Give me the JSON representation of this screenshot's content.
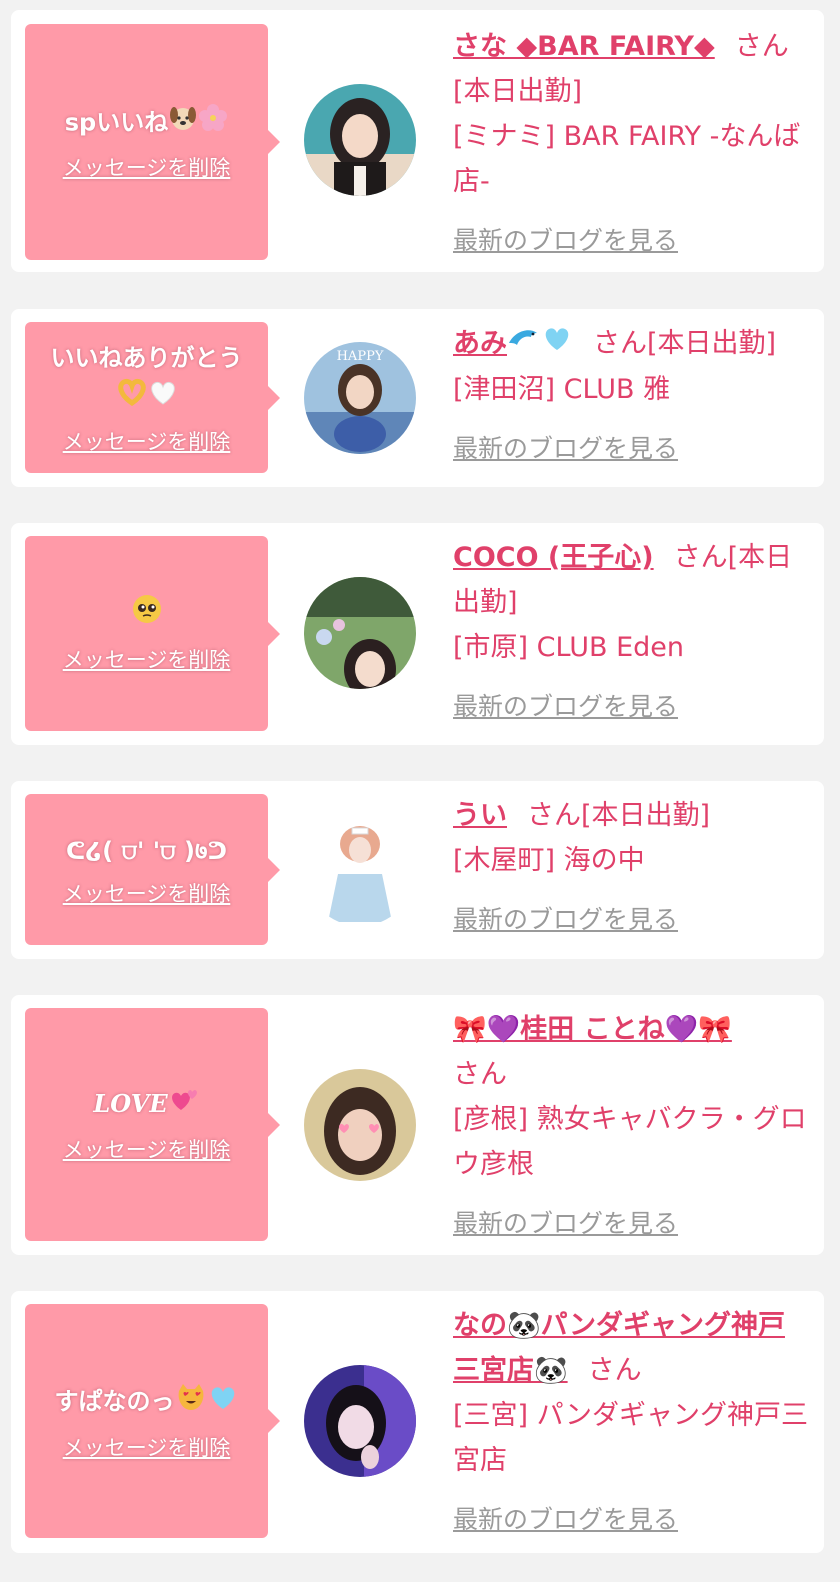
{
  "ui": {
    "delete_label": "メッセージを削除",
    "san_label": "さん",
    "blog_label": "最新のブログを見る"
  },
  "cards": [
    {
      "message": "spいいね",
      "message_emojis": [
        "dog-face-icon",
        "cherry-blossom-icon"
      ],
      "name": "さな ◆BAR FAIRY◆",
      "status": "[本日出勤]",
      "shop": "[ミナミ] BAR FAIRY -なんば店-"
    },
    {
      "message": "いいねありがとう",
      "message_emojis": [
        "heart-hands-icon",
        "white-heart-icon"
      ],
      "name": "あみ",
      "name_emojis": [
        "dolphin-icon",
        "light-blue-heart-icon"
      ],
      "status": "[本日出勤]",
      "shop": "[津田沼] CLUB 雅"
    },
    {
      "message": "",
      "message_emojis": [
        "pleading-face-icon"
      ],
      "name": "COCO (王子心)",
      "status": "[本日出勤]",
      "shop": "[市原] CLUB Eden"
    },
    {
      "message": "ᕦ໒( ⩌' '⩌ )७ᕤ",
      "name": "うい",
      "status": "[本日出勤]",
      "shop": "[木屋町] 海の中"
    },
    {
      "message": "LOVE",
      "message_emojis": [
        "two-hearts-icon"
      ],
      "name": "🎀💜桂田 ことね💜🎀",
      "status": "",
      "shop": "[彦根] 熟女キャバクラ・グロウ彦根"
    },
    {
      "message": "すぱなのっ",
      "message_emojis": [
        "heart-eyes-cat-icon",
        "light-blue-heart-icon"
      ],
      "name": "なの🐼パンダギャング神戸三宮店🐼",
      "status": "",
      "shop": "[三宮] パンダギャング神戸三宮店"
    }
  ],
  "colors": {
    "bubble": "#ff9aa8",
    "accent": "#e0406a",
    "link_gray": "#9a9a9a",
    "background": "#f2f2f2"
  }
}
